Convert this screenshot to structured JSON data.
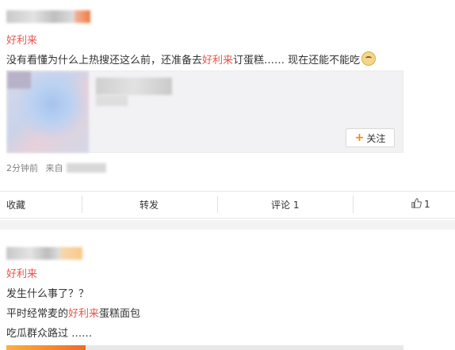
{
  "post1": {
    "topic_tag": "好利来",
    "text_before": "没有看懂为什么上热搜还这么前，还准备去",
    "text_highlight": "好利来",
    "text_after": "订蛋糕…… 现在还能不能吃",
    "emoji_icon": "doge-emoji-icon",
    "card": {
      "follow_label": "关注",
      "follow_icon": "plus-icon"
    },
    "meta": {
      "time": "2分钟前",
      "source_prefix": "来自"
    },
    "actions": {
      "favorite": "收藏",
      "repost": "转发",
      "comment": "评论 1",
      "like_count": "1",
      "like_icon": "thumbs-up-icon"
    }
  },
  "post2": {
    "topic_tag": "好利来",
    "line1": "发生什么事了？？",
    "line2_before": "平时经常麦的",
    "line2_highlight": "好利来",
    "line2_after": "蛋糕面包",
    "line3": "吃瓜群众路过 ……"
  },
  "colors": {
    "highlight": "#e8554e",
    "accent_orange": "#ff8200"
  }
}
